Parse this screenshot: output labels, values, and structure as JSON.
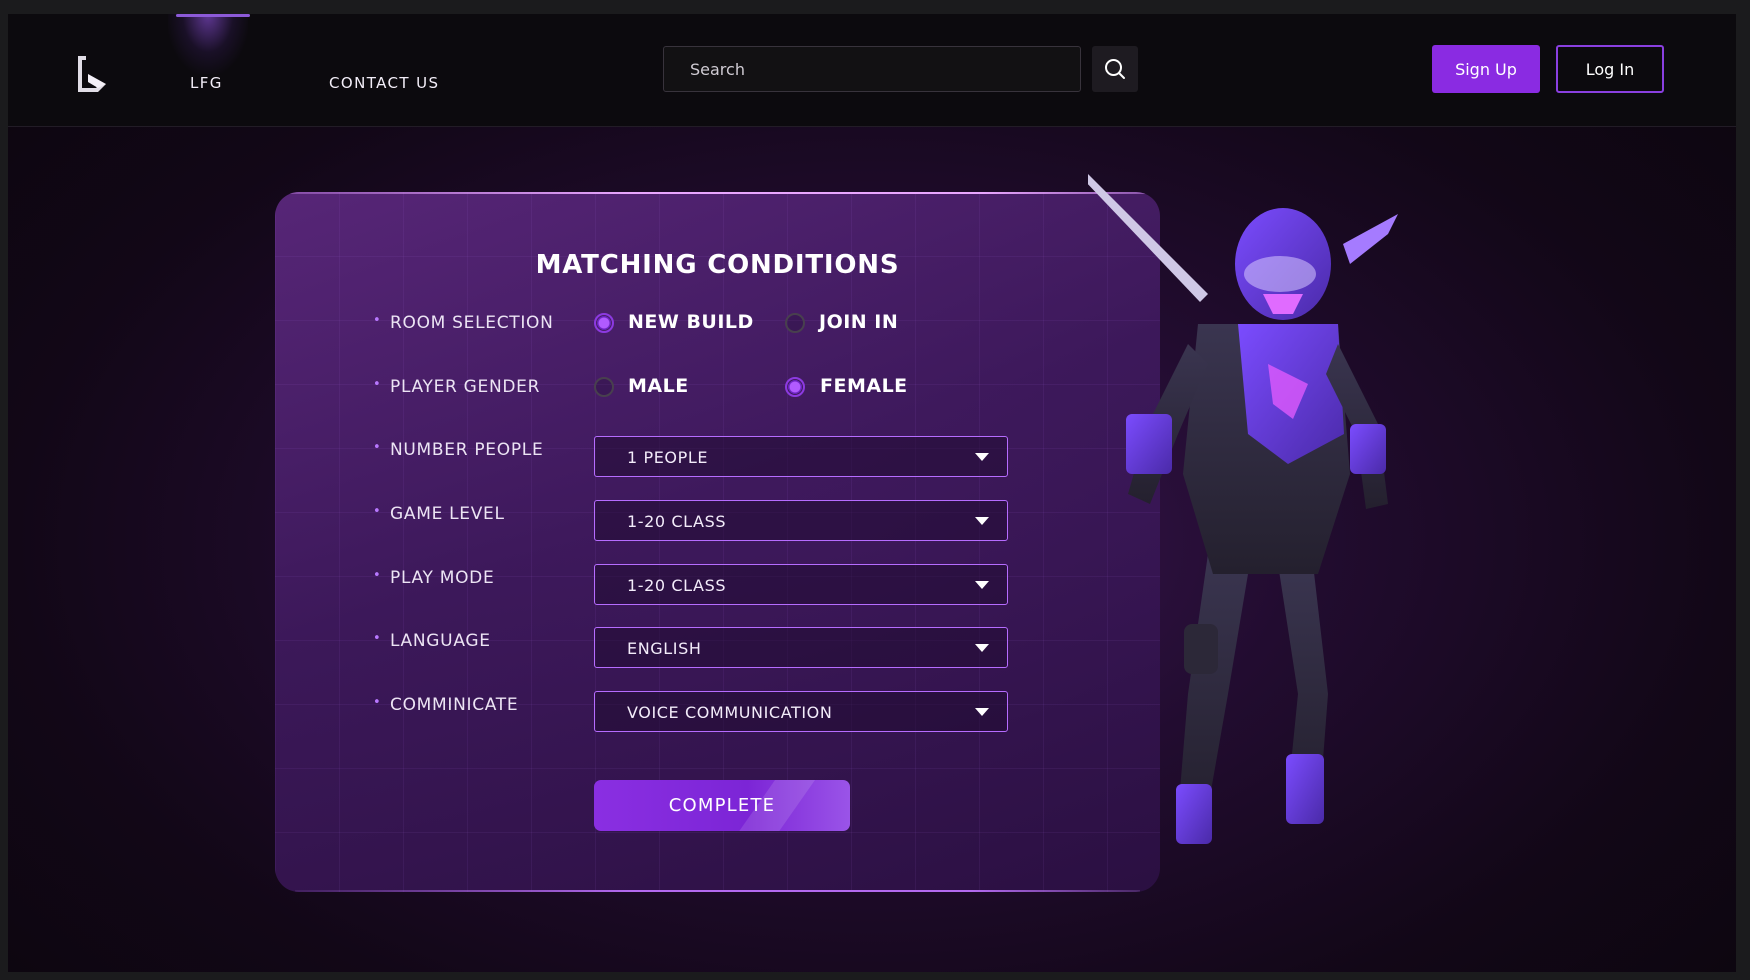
{
  "nav": {
    "items": [
      {
        "label": "LFG",
        "active": true
      },
      {
        "label": "CONTACT US",
        "active": false
      }
    ]
  },
  "search": {
    "placeholder": "Search"
  },
  "auth": {
    "signup_label": "Sign Up",
    "login_label": "Log In"
  },
  "panel": {
    "title": "MATCHING CONDITIONS",
    "room_selection": {
      "label": "ROOM SELECTION",
      "options": [
        {
          "label": "NEW BUILD",
          "checked": true
        },
        {
          "label": "JOIN IN",
          "checked": false
        }
      ]
    },
    "player_gender": {
      "label": "PLAYER GENDER",
      "options": [
        {
          "label": "MALE",
          "checked": false
        },
        {
          "label": "FEMALE",
          "checked": true
        }
      ]
    },
    "selects": [
      {
        "label": "NUMBER  PEOPLE",
        "value": "1 PEOPLE"
      },
      {
        "label": "GAME LEVEL",
        "value": "1-20 CLASS"
      },
      {
        "label": "PLAY MODE",
        "value": "1-20 CLASS"
      },
      {
        "label": "LANGUAGE",
        "value": "ENGLISH"
      },
      {
        "label": "COMMINICATE",
        "value": "VOICE COMMUNICATION"
      }
    ],
    "complete_label": "COMPLETE"
  },
  "colors": {
    "accent": "#8a2be2",
    "select_border": "#b66cff",
    "panel_edge": "#e9a6ff"
  },
  "icons": [
    "logo-icon",
    "search-icon",
    "chevron-down-icon"
  ]
}
